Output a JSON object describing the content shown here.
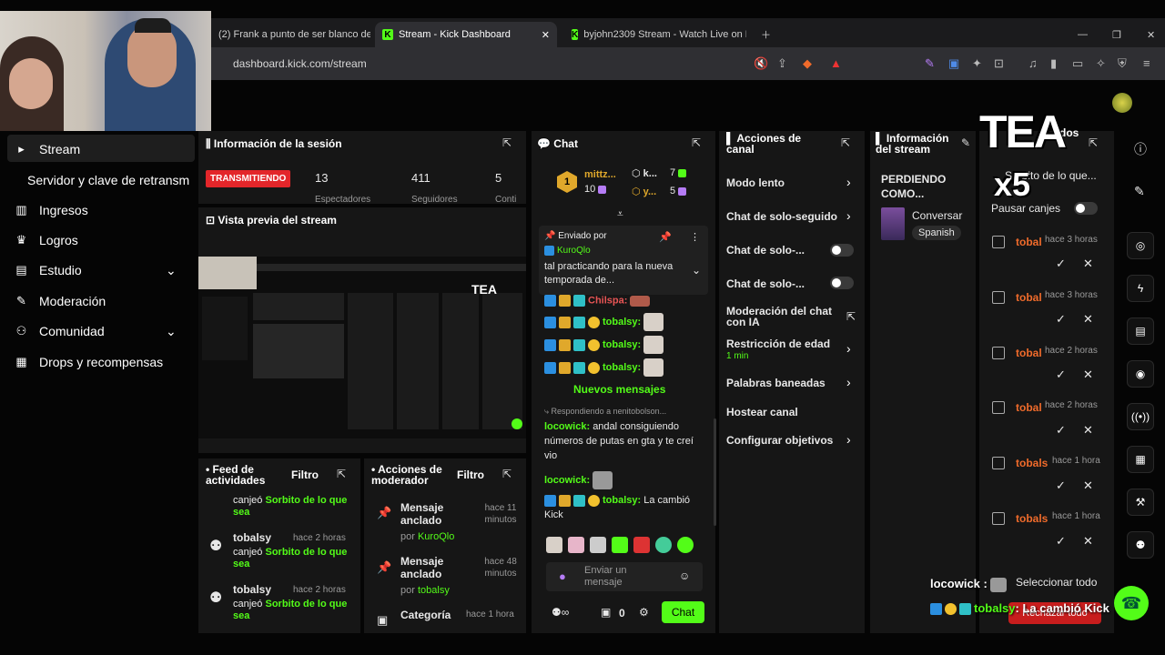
{
  "browser": {
    "tabs": [
      {
        "label": "(2) Frank a punto de ser blanco de fer"
      },
      {
        "label": "Stream - Kick Dashboard"
      },
      {
        "label": "byjohn2309 Stream - Watch Live on K"
      }
    ],
    "url": "dashboard.kick.com/stream",
    "window_controls": [
      "—",
      "❐",
      "✕"
    ]
  },
  "sidebar": {
    "items": [
      {
        "label": "Stream",
        "icon": "stream-icon"
      },
      {
        "label": "Servidor y clave de retransm"
      },
      {
        "label": "Ingresos",
        "icon": "chart-icon"
      },
      {
        "label": "Logros",
        "icon": "trophy-icon"
      },
      {
        "label": "Estudio",
        "icon": "studio-icon"
      },
      {
        "label": "Moderación",
        "icon": "wrench-icon"
      },
      {
        "label": "Comunidad",
        "icon": "people-icon"
      },
      {
        "label": "Drops y recompensas",
        "icon": "drops-icon"
      }
    ]
  },
  "session": {
    "title": "Información de la sesión",
    "status": "TRANSMITIENDO",
    "stats": [
      "13",
      "411",
      "5"
    ],
    "stat_labels": [
      "Espectadores",
      "Seguidores",
      "Conti"
    ]
  },
  "preview": {
    "title": "Vista previa del stream"
  },
  "activity_feed": {
    "title": "Feed de actividades",
    "filter": "Filtro",
    "items": [
      {
        "user": "",
        "time": "",
        "action": "canjeó",
        "reward": "Sorbito de lo que sea"
      },
      {
        "user": "tobalsy",
        "time": "hace 2 horas",
        "action": "canjeó",
        "reward": "Sorbito de lo que sea"
      },
      {
        "user": "tobalsy",
        "time": "hace 2 horas",
        "action": "canjeó",
        "reward": "Sorbito de lo que sea"
      }
    ]
  },
  "mod_actions": {
    "title": "Acciones de moderador",
    "filter": "Filtro",
    "items": [
      {
        "title": "Mensaje anclado",
        "by_label": "por",
        "by": "KuroQlo",
        "time": "hace 11 minutos"
      },
      {
        "title": "Mensaje anclado",
        "by_label": "por",
        "by": "tobalsy",
        "time": "hace 48 minutos"
      },
      {
        "title": "Categoría",
        "by_label": "",
        "by": "",
        "time": "hace 1 hora"
      }
    ]
  },
  "chat": {
    "title": "Chat",
    "top_users": [
      {
        "name": "mittz...",
        "count": "10"
      },
      {
        "name": "k...",
        "count": "7"
      },
      {
        "name": "y...",
        "count": "5"
      }
    ],
    "pinned": {
      "header": "Enviado por",
      "author": "KuroQlo",
      "text": "tal practicando para la nueva temporada de..."
    },
    "messages": [
      {
        "user": "Chilspa:",
        "text": ""
      },
      {
        "user": "tobalsy:",
        "text": ""
      },
      {
        "user": "tobalsy:",
        "text": ""
      },
      {
        "user": "tobalsy:",
        "text": ""
      }
    ],
    "new_messages": "Nuevos mensajes",
    "reply_to": "Respondiendo a nenitobolson...",
    "later": [
      {
        "user": "locowick:",
        "text": "andal consiguiendo números de putas en gta y te creí vio"
      },
      {
        "user": "locowick:",
        "text": ""
      },
      {
        "user": "tobalsy:",
        "text": "La cambió Kick"
      }
    ],
    "input_placeholder": "Enviar un mensaje",
    "counter": "0",
    "send_label": "Chat"
  },
  "channel_actions": {
    "title": "Acciones de canal",
    "items": [
      {
        "label": "Modo lento",
        "control": "chevron"
      },
      {
        "label": "Chat de solo-seguido",
        "control": "chevron"
      },
      {
        "label": "Chat de solo-...",
        "control": "toggle"
      },
      {
        "label": "Chat de solo-...",
        "control": "toggle"
      },
      {
        "label": "Moderación del chat con IA",
        "control": "external"
      },
      {
        "label": "Restricción de edad",
        "sub": "1 min",
        "control": "chevron"
      },
      {
        "label": "Palabras baneadas",
        "control": "chevron"
      },
      {
        "label": "Hostear canal",
        "control": "none"
      },
      {
        "label": "Configurar objetivos",
        "control": "chevron"
      }
    ]
  },
  "stream_info": {
    "title": "Información del stream",
    "stream_title": "PERDIENDO COMO...",
    "category": "Conversar",
    "language": "Spanish"
  },
  "redeems": {
    "title_partial": "dos",
    "reward": "Sorbito de lo que...",
    "pause_label": "Pausar canjes",
    "rows": [
      {
        "user": "tobal",
        "time": "hace 3 horas"
      },
      {
        "user": "tobal",
        "time": "hace 3 horas"
      },
      {
        "user": "tobal",
        "time": "hace 2 horas"
      },
      {
        "user": "tobal",
        "time": "hace 2 horas"
      },
      {
        "user": "tobals",
        "time": "hace 1 hora"
      },
      {
        "user": "tobals",
        "time": "hace 1 hora"
      }
    ],
    "select_all": "Seleccionar todo",
    "reject_all": "Rechazar todo"
  },
  "overlay": {
    "watermark": "TEA",
    "watermark_sub": "x5",
    "chat_line1_user": "locowick :",
    "chat_line2_user": "tobalsy",
    "chat_line2_text": ": La cambió Kick"
  },
  "colors": {
    "kick_green": "#53fc18",
    "live_red": "#e3262a",
    "panel_bg": "#161616"
  }
}
